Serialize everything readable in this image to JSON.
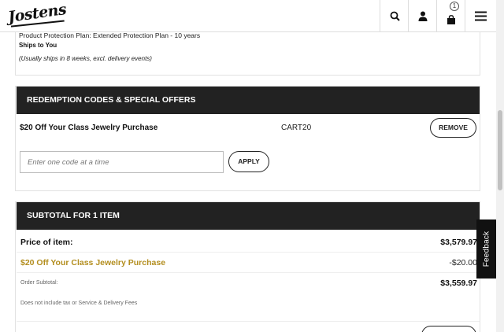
{
  "header": {
    "logo_text": "Jostens",
    "cart_count": "1"
  },
  "order_info": {
    "plan": "Product Protection Plan: Extended Protection Plan - 10 years",
    "ships_to": "Ships to You",
    "ship_note": "(Usually ships in 8 weeks, excl. delivery events)"
  },
  "redemption": {
    "title": "REDEMPTION CODES & SPECIAL OFFERS",
    "applied_name": "$20 Off Your Class Jewelry Purchase",
    "applied_code": "CART20",
    "remove_label": "REMOVE",
    "input_placeholder": "Enter one code at a time",
    "input_value": "",
    "apply_label": "APPLY"
  },
  "subtotal": {
    "title": "SUBTOTAL FOR 1 ITEM",
    "price_label": "Price of item:",
    "price_value": "$3,579.97",
    "discount_label": "$20 Off Your Class Jewelry Purchase",
    "discount_value": "-$20.00",
    "order_subtotal_label": "Order Subtotal:",
    "order_subtotal_value": "$3,559.97",
    "tax_note": "Does not include tax or Service & Delivery Fees"
  },
  "feedback_label": "Feedback",
  "colors": {
    "header_bar": "#222222",
    "discount_gold": "#b38e1f"
  }
}
